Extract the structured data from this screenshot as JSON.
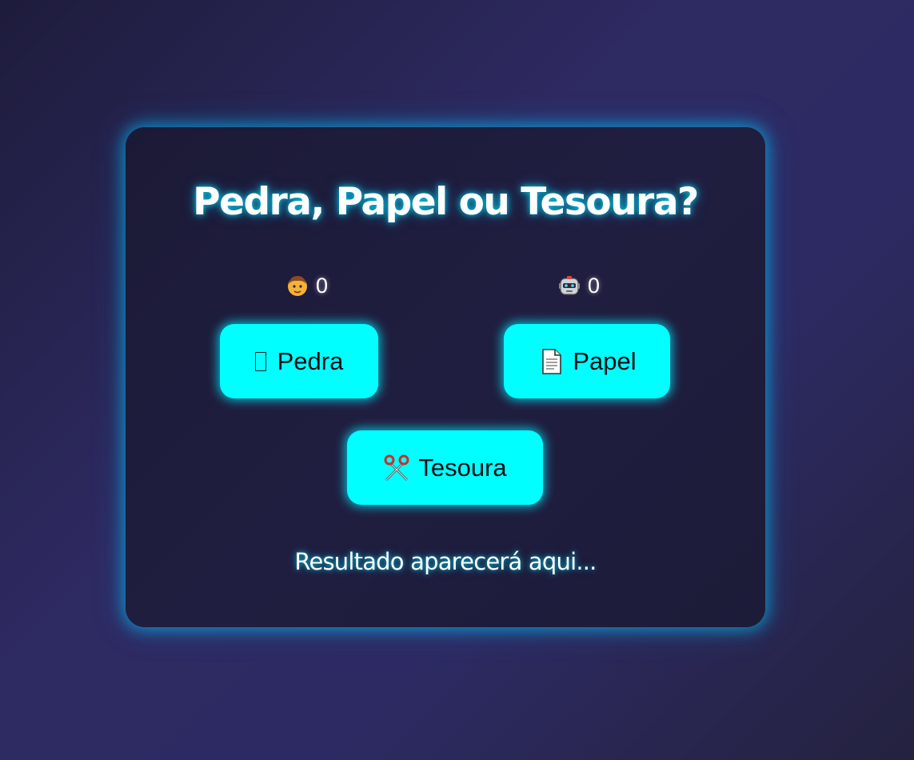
{
  "game": {
    "title": "Pedra, Papel ou Tesoura?",
    "result_text": "Resultado aparecerá aqui..."
  },
  "scores": {
    "player": {
      "icon": "person-face-icon",
      "value": "0"
    },
    "computer": {
      "icon": "robot-icon",
      "value": "0"
    }
  },
  "choices": [
    {
      "label": "Pedra",
      "icon": "rock-icon"
    },
    {
      "label": "Papel",
      "icon": "page-icon"
    },
    {
      "label": "Tesoura",
      "icon": "scissors-icon"
    }
  ],
  "colors": {
    "button_bg": "#00ffff",
    "glow": "#00c8ff",
    "card_bg": "#1e1c3e",
    "page_bg": "#2d2a63"
  }
}
